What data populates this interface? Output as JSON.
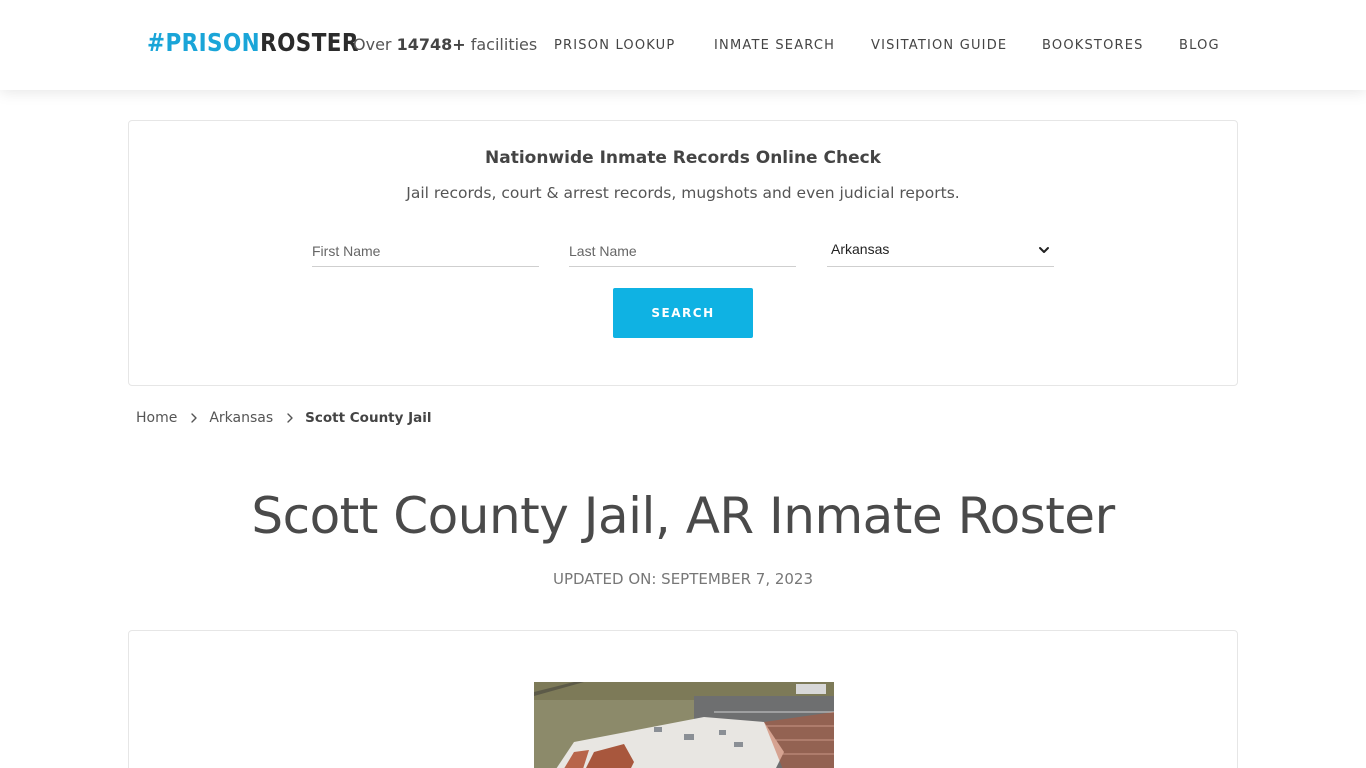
{
  "header": {
    "logo": {
      "hash": "#",
      "part1": "PRISON",
      "part2": "ROSTER"
    },
    "facilities": {
      "prefix": "Over ",
      "count": "14748+",
      "suffix": " facilities"
    },
    "nav": [
      {
        "label": "PRISON LOOKUP"
      },
      {
        "label": "INMATE SEARCH"
      },
      {
        "label": "VISITATION GUIDE"
      },
      {
        "label": "BOOKSTORES"
      },
      {
        "label": "BLOG"
      }
    ]
  },
  "search": {
    "title": "Nationwide Inmate Records Online Check",
    "subtitle": "Jail records, court & arrest records, mugshots and even judicial reports.",
    "first_name_placeholder": "First Name",
    "last_name_placeholder": "Last Name",
    "state_selected": "Arkansas",
    "button_label": "SEARCH"
  },
  "breadcrumb": {
    "items": [
      "Home",
      "Arkansas"
    ],
    "current": "Scott County Jail"
  },
  "page": {
    "title": "Scott County Jail, AR Inmate Roster",
    "updated": "UPDATED ON: SEPTEMBER 7, 2023"
  },
  "colors": {
    "accent": "#0fb2e3",
    "logo_blue": "#1aa5d8",
    "text_dark": "#4a4a4a"
  },
  "icons": {
    "breadcrumb_separator": "chevron-right-icon",
    "select_arrow": "chevron-down-icon"
  }
}
